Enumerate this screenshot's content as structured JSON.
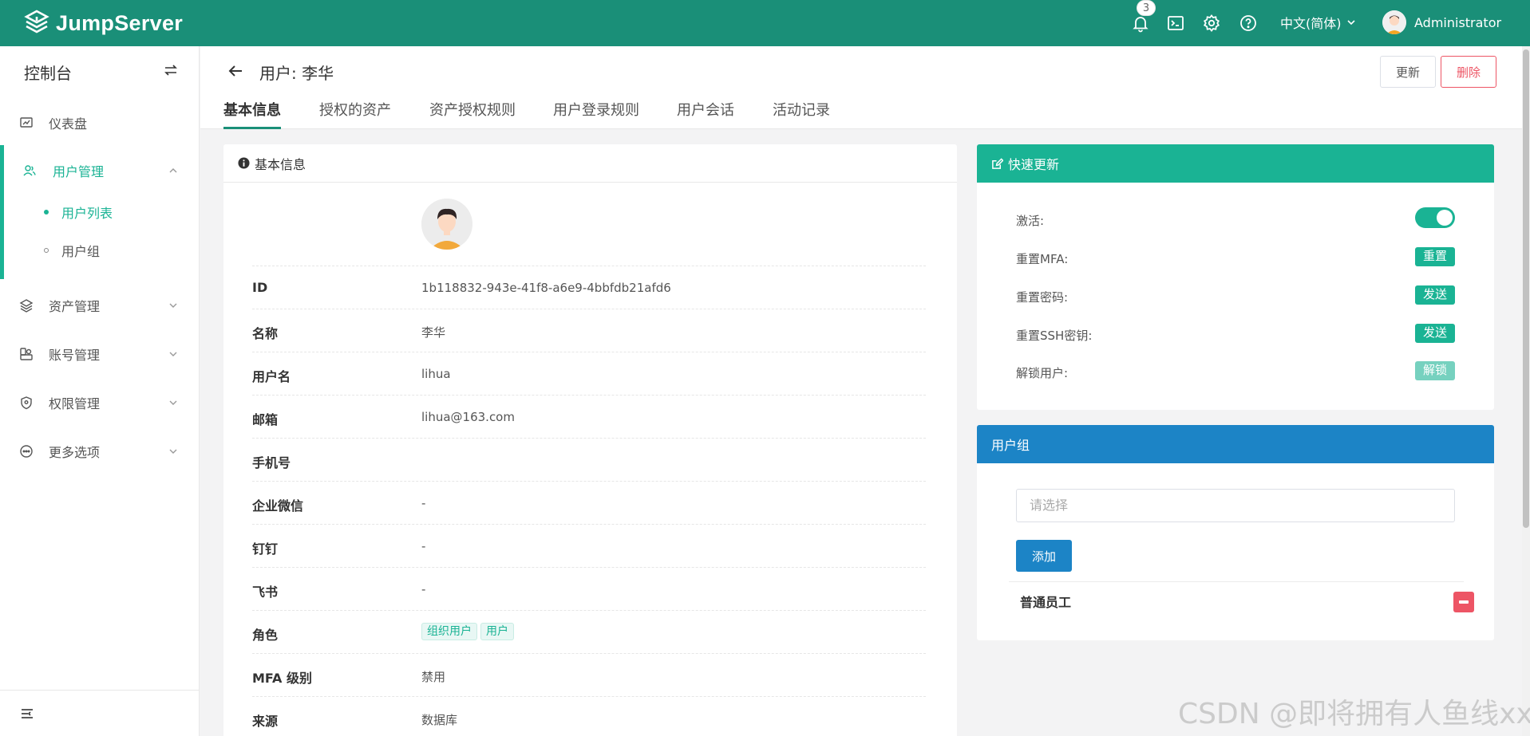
{
  "app": {
    "name": "JumpServer"
  },
  "topbar": {
    "notification_count": "3",
    "language": "中文(简体)",
    "username": "Administrator"
  },
  "sidebar": {
    "title": "控制台",
    "items": [
      {
        "label": "仪表盘"
      },
      {
        "label": "用户管理"
      },
      {
        "label": "资产管理"
      },
      {
        "label": "账号管理"
      },
      {
        "label": "权限管理"
      },
      {
        "label": "更多选项"
      }
    ],
    "sub_items": [
      {
        "label": "用户列表"
      },
      {
        "label": "用户组"
      }
    ]
  },
  "page": {
    "title": "用户: 李华",
    "update_label": "更新",
    "delete_label": "删除",
    "tabs": [
      {
        "label": "基本信息"
      },
      {
        "label": "授权的资产"
      },
      {
        "label": "资产授权规则"
      },
      {
        "label": "用户登录规则"
      },
      {
        "label": "用户会话"
      },
      {
        "label": "活动记录"
      }
    ]
  },
  "basic": {
    "title": "基本信息",
    "rows": [
      {
        "key": "ID",
        "value": "1b118832-943e-41f8-a6e9-4bbfdb21afd6"
      },
      {
        "key": "名称",
        "value": "李华"
      },
      {
        "key": "用户名",
        "value": "lihua"
      },
      {
        "key": "邮箱",
        "value": "lihua@163.com"
      },
      {
        "key": "手机号",
        "value": ""
      },
      {
        "key": "企业微信",
        "value": "-"
      },
      {
        "key": "钉钉",
        "value": "-"
      },
      {
        "key": "飞书",
        "value": "-"
      },
      {
        "key": "角色",
        "value": ""
      },
      {
        "key": "MFA 级别",
        "value": "禁用"
      },
      {
        "key": "来源",
        "value": "数据库"
      }
    ],
    "roles": [
      "组织用户",
      "用户"
    ]
  },
  "quick_update": {
    "title": "快速更新",
    "active_label": "激活:",
    "active": true,
    "reset_mfa_label": "重置MFA:",
    "reset_mfa_btn": "重置",
    "reset_password_label": "重置密码:",
    "reset_password_btn": "发送",
    "reset_ssh_label": "重置SSH密钥:",
    "reset_ssh_btn": "发送",
    "unlock_label": "解锁用户:",
    "unlock_btn": "解锁"
  },
  "user_groups": {
    "title": "用户组",
    "select_placeholder": "请选择",
    "add_label": "添加",
    "groups": [
      {
        "name": "普通员工"
      }
    ]
  },
  "watermark": "CSDN @即将拥有人鱼线xx",
  "colors": {
    "topbar": "#1a8f78",
    "primary": "#1ab394",
    "blue": "#1c84c6",
    "danger": "#ed5565"
  }
}
